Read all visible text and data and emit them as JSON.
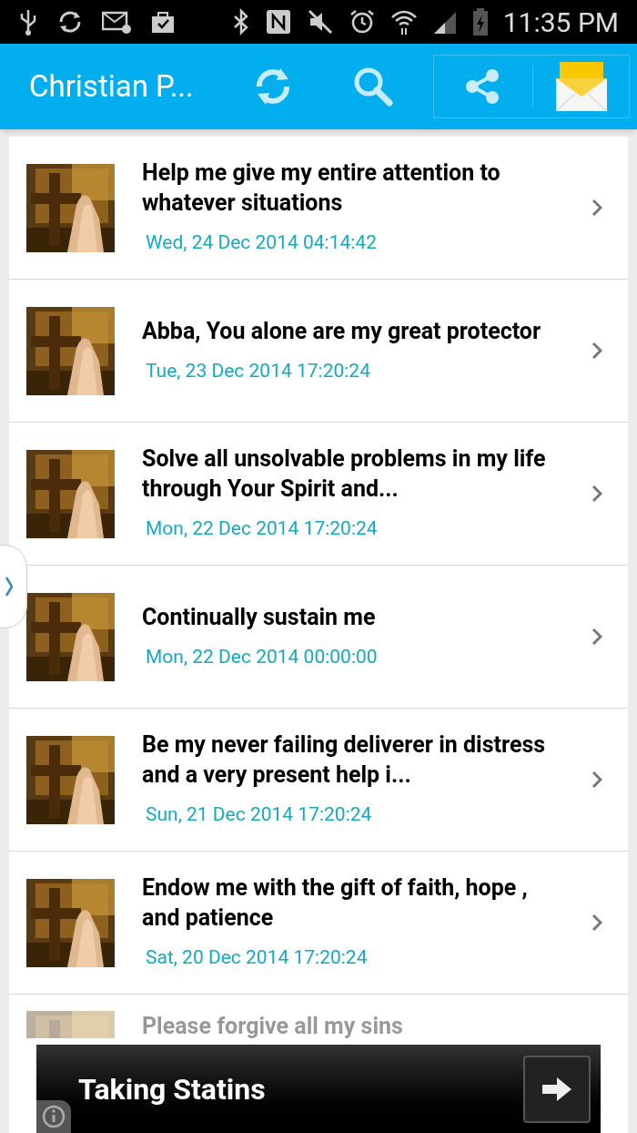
{
  "status_bar": {
    "time": "11:35 PM"
  },
  "app_bar": {
    "title": "Christian P..."
  },
  "posts": [
    {
      "title": "Help me give my entire attention to whatever situations",
      "date": "Wed, 24 Dec 2014 04:14:42"
    },
    {
      "title": "Abba, You alone are my great protector",
      "date": "Tue, 23 Dec 2014 17:20:24"
    },
    {
      "title": "Solve all unsolvable problems in my life through Your Spirit and...",
      "date": "Mon, 22 Dec 2014 17:20:24"
    },
    {
      "title": "Continually sustain me",
      "date": "Mon, 22 Dec 2014 00:00:00"
    },
    {
      "title": "Be my never failing deliverer in distress and a very present help i...",
      "date": "Sun, 21 Dec 2014 17:20:24"
    },
    {
      "title": "Endow me with the gift of faith, hope , and patience",
      "date": "Sat, 20 Dec 2014 17:20:24"
    }
  ],
  "partial_post": {
    "title": "Please forgive all my sins"
  },
  "ad": {
    "text": "Taking Statins"
  }
}
